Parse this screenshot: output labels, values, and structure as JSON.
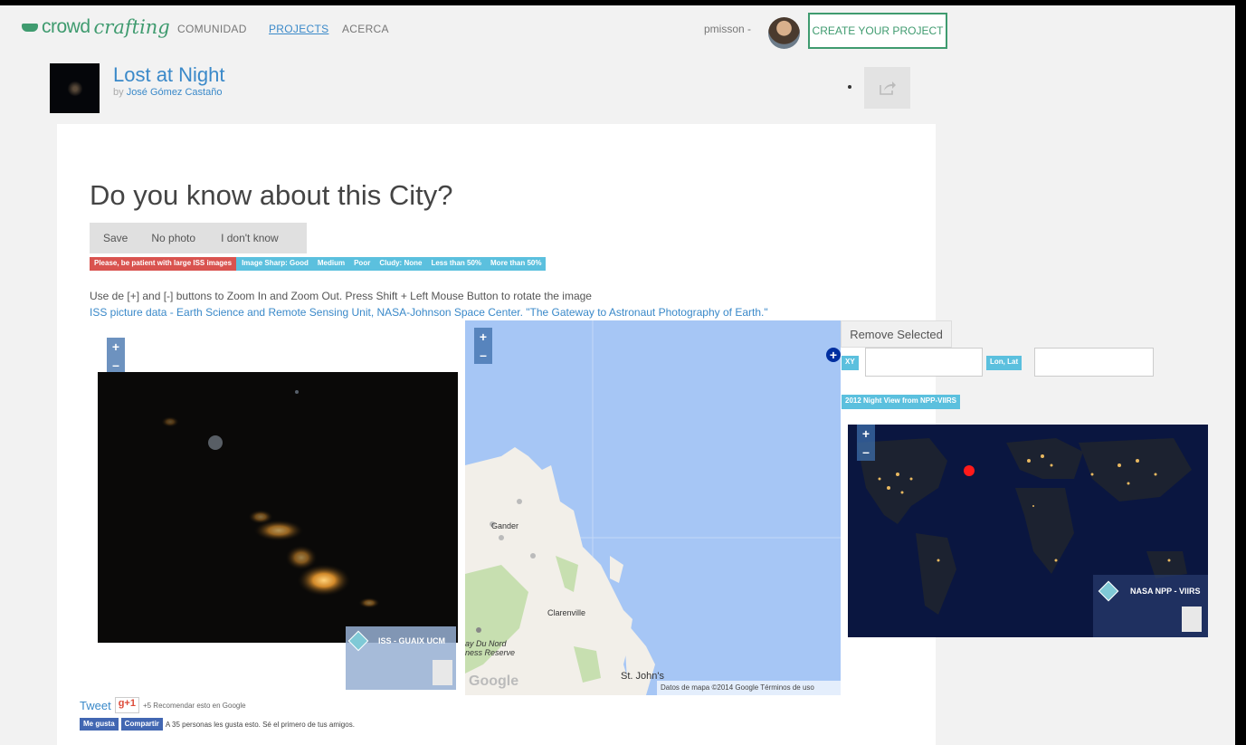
{
  "nav": {
    "logo_crowd": "crowd",
    "logo_crafting": "crafting",
    "items": [
      "COMUNIDAD",
      "PROJECTS",
      "ACERCA"
    ],
    "user": "pmisson -",
    "create_label": "CREATE YOUR PROJECT"
  },
  "project": {
    "title": "Lost at Night",
    "by": "by",
    "author": "José Gómez Castaño",
    "dot": "·"
  },
  "task": {
    "heading": "Do you know about this City?",
    "buttons": [
      "Save",
      "No photo",
      "I don't know"
    ],
    "badges": {
      "patient": "Please, be patient with large ISS images",
      "sharp": "Image Sharp: Good",
      "medium": "Medium",
      "poor": "Poor",
      "cloudy": "Cludy: None",
      "less50": "Less than 50%",
      "more50": "More than 50%"
    },
    "instructions": "Use de [+] and [-] buttons to Zoom In and Zoom Out. Press Shift + Left Mouse Button to rotate the image",
    "credit": "ISS picture data - Earth Science and Remote Sensing Unit, NASA-Johnson Space Center. \"The Gateway to Astronaut Photography of Earth.\""
  },
  "iss_viewer": {
    "zoom_in": "+",
    "zoom_out": "–",
    "layer_label": "ISS - GUAIX UCM"
  },
  "map": {
    "zoom_in": "+",
    "zoom_out": "–",
    "places": [
      "Gander",
      "Clarenville",
      "St. John's",
      "ay Du Nord",
      "ness Reserve"
    ],
    "attribution": "Datos de mapa ©2014 Google   Términos de uso",
    "google": "Google"
  },
  "controls": {
    "remove_label": "Remove Selected",
    "plus": "+",
    "xy_label": "XY",
    "lonlat_label": "Lon, Lat",
    "night_label": "2012 Night View from NPP-VIIRS"
  },
  "night_viewer": {
    "zoom_in": "+",
    "zoom_out": "–",
    "layer_label": "NASA NPP - VIIRS"
  },
  "social": {
    "tweet": "Tweet",
    "gplus": "g+1",
    "gplus_count": "+5  Recomendar esto en Google",
    "like": "Me gusta",
    "share": "Compartir",
    "fb_text": "A 35 personas les gusta esto. Sé el primero de tus amigos."
  },
  "colors": {
    "brand_green": "#3f9b6f",
    "link_blue": "#3a89c9",
    "badge_red": "#d9534f",
    "badge_blue": "#5bc0de"
  }
}
